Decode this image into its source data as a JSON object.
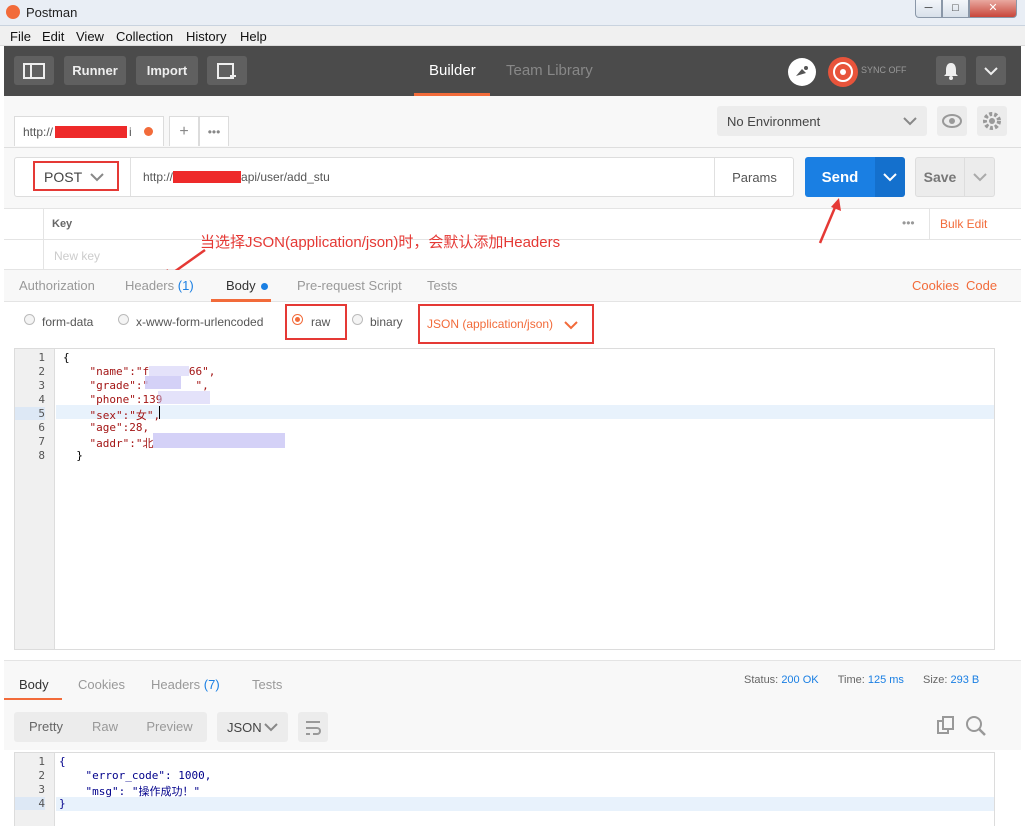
{
  "window": {
    "title": "Postman",
    "minimize": "─",
    "maximize": "□",
    "close": "✕"
  },
  "menu": [
    "File",
    "Edit",
    "View",
    "Collection",
    "History",
    "Help"
  ],
  "toolbar": {
    "runner": "Runner",
    "import": "Import",
    "tab_builder": "Builder",
    "tab_team_library": "Team Library",
    "sync": "SYNC OFF",
    "accent": "#f26b3a"
  },
  "request_tab": {
    "url_prefix": "http://",
    "url_suffix": "i"
  },
  "environment": {
    "selected": "No Environment"
  },
  "request": {
    "method": "POST",
    "url_prefix": "http://",
    "url_suffix": "api/user/add_stu",
    "params": "Params",
    "send": "Send",
    "save": "Save",
    "send_color": "#1a7fe3"
  },
  "headers_table": {
    "key_header": "Key",
    "bulk_edit": "Bulk Edit",
    "new_key_placeholder": "New key"
  },
  "annotation": "当选择JSON(application/json)时，会默认添加Headers",
  "builder_tabs": {
    "authorization": "Authorization",
    "headers": "Headers",
    "headers_count": "(1)",
    "body": "Body",
    "prerequest": "Pre-request Script",
    "tests": "Tests",
    "cookies": "Cookies",
    "code": "Code"
  },
  "body_options": {
    "form_data": "form-data",
    "urlencoded": "x-www-form-urlencoded",
    "raw": "raw",
    "binary": "binary",
    "content_type": "JSON (application/json)",
    "selected": "raw"
  },
  "request_body": {
    "line_numbers": [
      "1",
      "2",
      "3",
      "4",
      "5",
      "6",
      "7",
      "8"
    ],
    "lines": [
      "{",
      "    \"name\":\"f      66\",",
      "    \"grade\":\"       \",",
      "    \"phone\":139",
      "    \"sex\":\"女\",",
      "    \"age\":28,",
      "    \"addr\":\"北",
      "  }"
    ]
  },
  "response": {
    "tabs": {
      "body": "Body",
      "cookies": "Cookies",
      "headers": "Headers",
      "headers_count": "(7)",
      "tests": "Tests"
    },
    "status_label": "Status:",
    "status_value": "200 OK",
    "time_label": "Time:",
    "time_value": "125 ms",
    "size_label": "Size:",
    "size_value": "293 B",
    "view_modes": [
      "Pretty",
      "Raw",
      "Preview"
    ],
    "format": "JSON",
    "line_numbers": [
      "1",
      "2",
      "3",
      "4"
    ],
    "lines": [
      "{",
      "    \"error_code\": 1000,",
      "    \"msg\": \"操作成功！\"",
      "}"
    ]
  }
}
